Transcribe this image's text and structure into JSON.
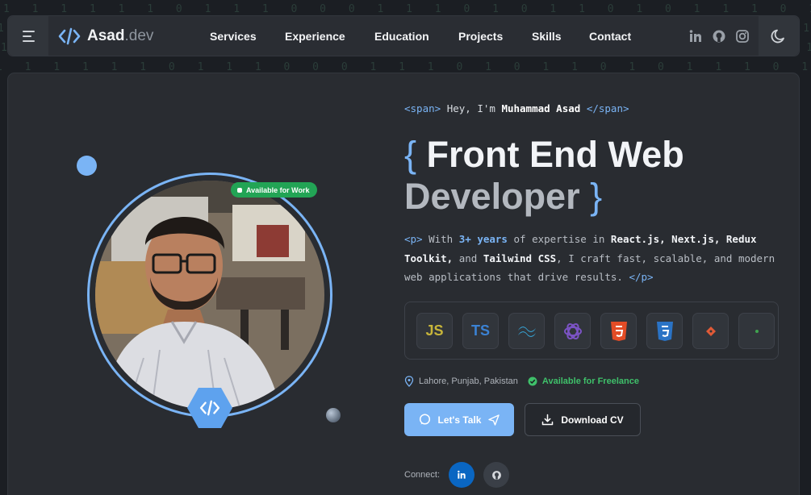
{
  "background_rain": "1 1 1 1 1 1 0 1 1 1 0 0 0 1 1 1 0 1 0 1 1 0 1 0 1 1 1 0 1 0 1 1 0 0 1 0 1 1 0 0 0 1 1 0 1 0",
  "nav": {
    "logo_name": "Asad",
    "logo_suffix": ".dev",
    "links": [
      "Services",
      "Experience",
      "Education",
      "Projects",
      "Skills",
      "Contact"
    ],
    "socials": [
      "linkedin-icon",
      "github-icon",
      "instagram-icon"
    ],
    "theme_icon": "moon-icon"
  },
  "hero": {
    "badge": "Available for Work",
    "intro_open": "<span>",
    "intro_text": "Hey, I'm",
    "intro_name": "Muhammad Asad",
    "intro_close": "</span>",
    "headline_line1_bracket": "{",
    "headline_line1": "Front End Web",
    "headline_line2": "Developer",
    "headline_line2_bracket": "}",
    "desc_open": "<p>",
    "desc_with": "With",
    "desc_years": "3+ years",
    "desc_part1": "of expertise in",
    "desc_tech1": "React.js, Next.js, Redux Toolkit,",
    "desc_and": "and",
    "desc_tech2": "Tailwind CSS",
    "desc_part2": ", I craft fast, scalable, and modern web applications that drive results.",
    "desc_close": "</p>",
    "tech_stack": [
      {
        "label": "JS",
        "icon": "javascript-icon",
        "color": "#c7b53a"
      },
      {
        "label": "TS",
        "icon": "typescript-icon",
        "color": "#3b82d4"
      },
      {
        "label": "",
        "icon": "tailwind-icon",
        "color": "#38bdf8"
      },
      {
        "label": "",
        "icon": "redux-icon",
        "color": "#7b53c4"
      },
      {
        "label": "",
        "icon": "html5-icon",
        "color": "#e34c26"
      },
      {
        "label": "",
        "icon": "css3-icon",
        "color": "#2a73c5"
      },
      {
        "label": "",
        "icon": "git-icon",
        "color": "#e05a37"
      },
      {
        "label": "",
        "icon": "node-icon",
        "color": "#3fa34f"
      }
    ],
    "location": "Lahore, Punjab, Pakistan",
    "availability": "Available for Freelance",
    "cta_primary": "Let's Talk",
    "cta_secondary": "Download CV",
    "connect_label": "Connect:"
  }
}
